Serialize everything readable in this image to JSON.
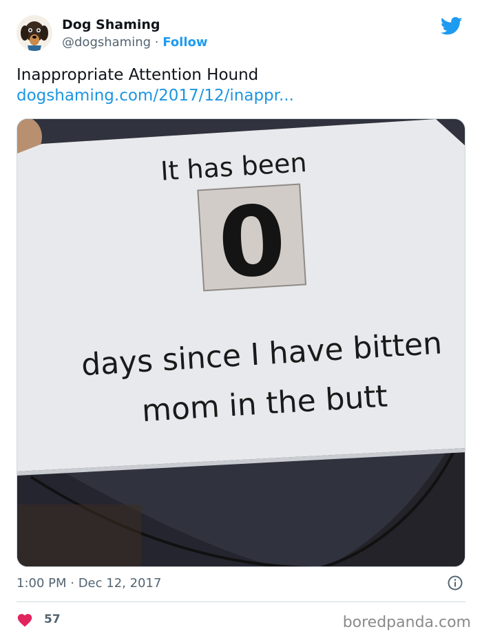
{
  "account": {
    "name": "Dog Shaming",
    "handle": "@dogshaming",
    "separator": " · ",
    "follow_label": "Follow"
  },
  "tweet": {
    "text": "Inappropriate Attention Hound",
    "link": "dogshaming.com/2017/12/inappr..."
  },
  "sign": {
    "line1": "It has been",
    "counter": "0",
    "line2": "days since I have bitten",
    "line3": "mom in the butt"
  },
  "meta": {
    "timestamp": "1:00 PM · Dec 12, 2017"
  },
  "engagement": {
    "likes": "57"
  },
  "watermark": "boredpanda.com",
  "colors": {
    "twitter_blue": "#1d9bf0",
    "like_red": "#e0245e",
    "muted": "#536471"
  },
  "icons": [
    "dog-avatar-icon",
    "twitter-bird-icon",
    "info-icon",
    "heart-icon"
  ]
}
